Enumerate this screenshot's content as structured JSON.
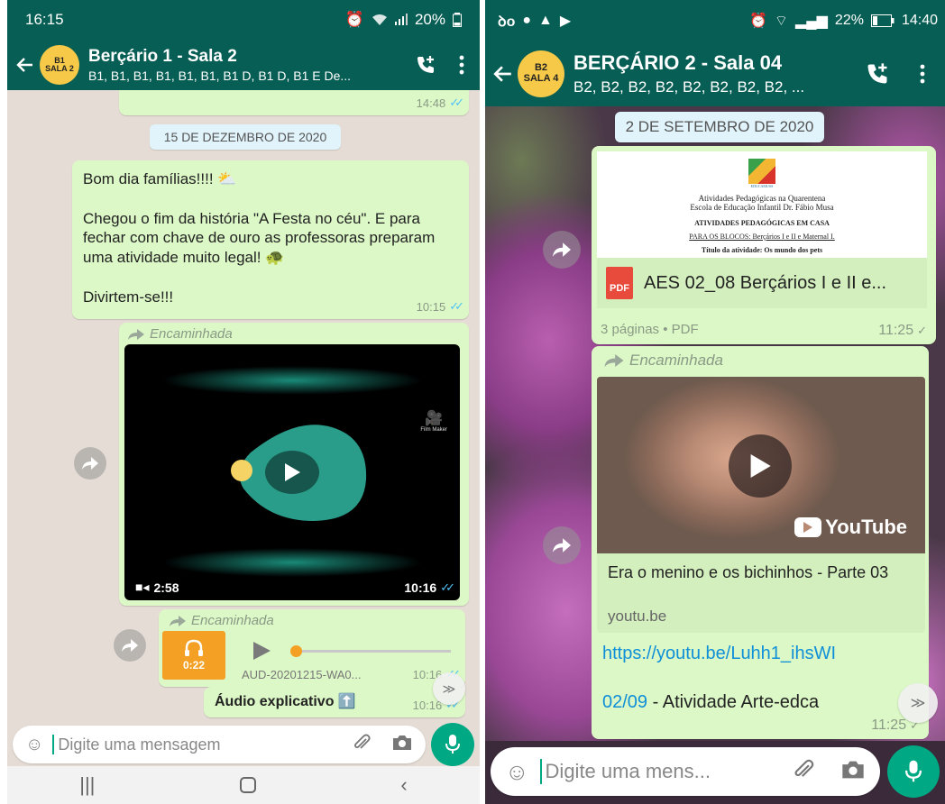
{
  "left": {
    "status": {
      "time": "16:15",
      "battery": "20%"
    },
    "header": {
      "avatar_line1": "B1",
      "avatar_line2": "SALA 2",
      "title": "Berçário 1 - Sala 2",
      "subtitle": "B1, B1, B1, B1, B1, B1, B1 D, B1 D, B1 E De..."
    },
    "first_time": "14:48",
    "date": "15 DE DEZEMBRO DE 2020",
    "text_message": {
      "text": "Bom dia famílias!!!! ⛅\n\nChegou o fim da história \"A Festa no céu\". E para fechar com chave de ouro as professoras preparam uma atividade muito legal! 🐢\n\nDivirtem-se!!!",
      "time": "10:15"
    },
    "video_message": {
      "forwarded_label": "Encaminhada",
      "duration": "2:58",
      "time": "10:16",
      "watermark": "Film Maker"
    },
    "audio_message": {
      "forwarded_label": "Encaminhada",
      "duration": "0:22",
      "filename": "AUD-20201215-WA0...",
      "time": "10:16"
    },
    "caption_message": {
      "text": "Áudio explicativo ⬆️",
      "time": "10:16"
    },
    "input": {
      "placeholder": "Digite uma mensagem"
    },
    "colors": {
      "header": "#075e54",
      "bubble": "#dcf8c6",
      "accent": "#00a884",
      "audio_orange": "#f4a024"
    }
  },
  "right": {
    "status": {
      "time": "14:40",
      "battery": "22%"
    },
    "header": {
      "avatar_line1": "B2",
      "avatar_line2": "SALA 4",
      "title": "BERÇÁRIO 2 - Sala 04",
      "subtitle": "B2, B2, B2, B2, B2, B2, B2, B2, ..."
    },
    "date": "2 DE SETEMBRO DE 2020",
    "pdf_message": {
      "preview_line1": "Atividades Pedagógicas na Quarentena",
      "preview_line2": "Escola de Educação Infantil Dr. Fábio Musa",
      "preview_line3": "ATIVIDADES PEDAGÓGICAS EM CASA",
      "preview_line4": "PARA OS BLOCOS: Berçários I e II e Maternal I.",
      "preview_line5": "Título da atividade: Os mundo dos pets",
      "logo_caption": "EDUCAMUSS",
      "file_badge": "PDF",
      "filename": "AES 02_08 Berçários I e II e...",
      "meta": "3 páginas • PDF",
      "time": "11:25"
    },
    "link_message": {
      "forwarded_label": "Encaminhada",
      "youtube_label": "YouTube",
      "link_title": "Era o menino e os bichinhos - Parte 03",
      "link_domain": "youtu.be",
      "url": "https://youtu.be/Luhh1_ihsWI",
      "line2_date": "02/09",
      "line2_text": " - Atividade Arte-edca",
      "time": "11:25"
    },
    "input": {
      "placeholder": "Digite uma mens..."
    }
  }
}
